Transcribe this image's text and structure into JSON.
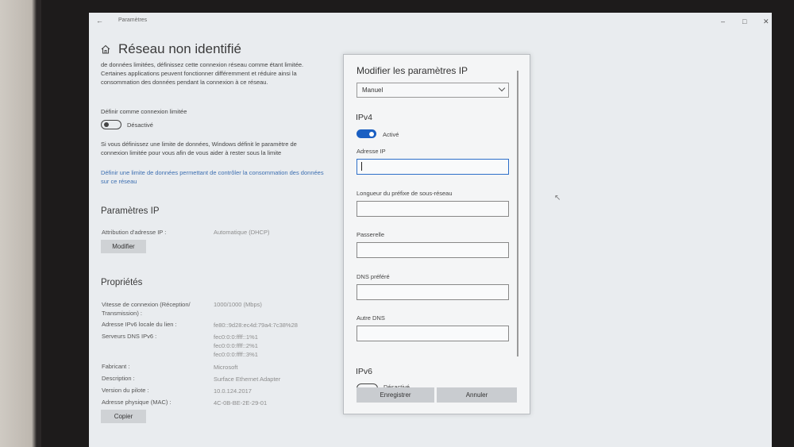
{
  "window": {
    "title": "Paramètres",
    "back_icon": "back-arrow-icon",
    "controls": [
      "minimize-icon",
      "maximize-icon",
      "close-icon"
    ]
  },
  "page": {
    "title": "Réseau non identifié",
    "description": "de données limitées, définissez cette connexion réseau comme étant limitée. Certaines applications peuvent fonctionner différemment et réduire ainsi la consommation des données pendant la connexion à ce réseau.",
    "metered_label": "Définir comme connexion limitée",
    "metered_state": "Désactivé",
    "metered_note": "Si vous définissez une limite de données, Windows définit le paramètre de connexion limitée pour vous afin de vous aider à rester sous la limite",
    "data_limit_link": "Définir une limite de données permettant de contrôler la consommation des données sur ce réseau"
  },
  "ip_settings": {
    "title": "Paramètres IP",
    "assignment_label": "Attribution d'adresse IP :",
    "assignment_value": "Automatique (DHCP)",
    "modify_button": "Modifier"
  },
  "properties": {
    "title": "Propriétés",
    "rows": [
      {
        "key": "Vitesse de connexion (Réception/ Transmission) :",
        "value": "1000/1000 (Mbps)"
      },
      {
        "key": "Adresse IPv6 locale du lien :",
        "value": "fe80::9d28:ec4d:79a4:7c38%28"
      },
      {
        "key": "Serveurs DNS IPv6 :",
        "value": "fec0:0:0:ffff::1%1\nfec0:0:0:ffff::2%1\nfec0:0:0:ffff::3%1"
      },
      {
        "key": "Fabricant :",
        "value": "Microsoft"
      },
      {
        "key": "Description :",
        "value": "Surface Ethernet Adapter"
      },
      {
        "key": "Version du pilote :",
        "value": "10.0.124.2017"
      },
      {
        "key": "Adresse physique (MAC) :",
        "value": "4C-0B-BE-2E-29-01"
      }
    ],
    "copy_button": "Copier"
  },
  "dialog": {
    "title": "Modifier les paramètres IP",
    "mode": "Manuel",
    "ipv4_title": "IPv4",
    "ipv4_state": "Activé",
    "fields": [
      {
        "label": "Adresse IP",
        "value": ""
      },
      {
        "label": "Longueur du préfixe de sous-réseau",
        "value": ""
      },
      {
        "label": "Passerelle",
        "value": ""
      },
      {
        "label": "DNS préféré",
        "value": ""
      },
      {
        "label": "Autre DNS",
        "value": ""
      }
    ],
    "ipv6_title": "IPv6",
    "ipv6_state": "Désactivé",
    "save_button": "Enregistrer",
    "cancel_button": "Annuler"
  },
  "colors": {
    "accent": "#1a5fc2",
    "link": "#3d6fb1",
    "screen_bg": "#e9ecef"
  }
}
